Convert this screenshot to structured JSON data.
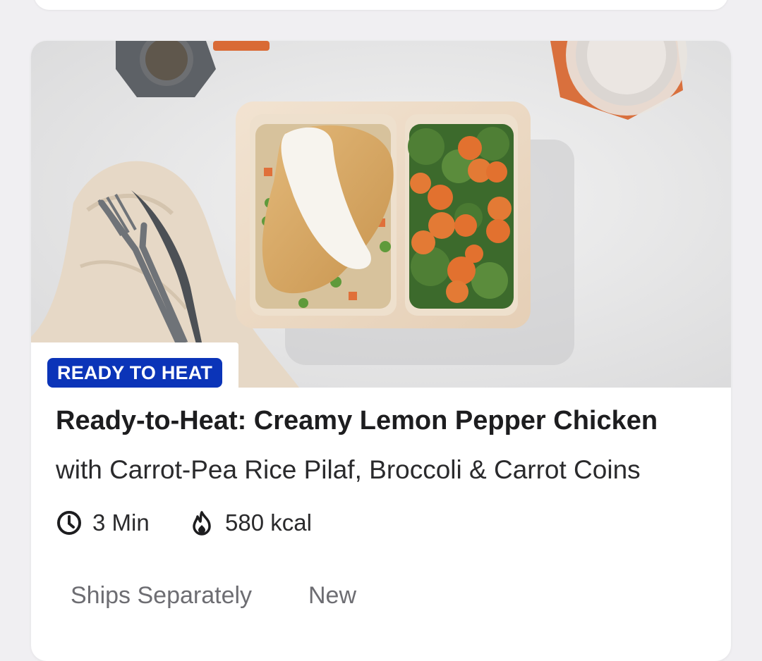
{
  "card": {
    "image_alt": "Ready-to-Heat Creamy Lemon Pepper Chicken meal in a two-compartment tray",
    "badge": "READY TO HEAT",
    "title": "Ready-to-Heat: Creamy Lemon Pepper Chicken",
    "subtitle": "with Carrot-Pea Rice Pilaf, Broccoli & Carrot Coins",
    "prep_time": "3 Min",
    "calories": "580 kcal",
    "tags": [
      "Ships Separately",
      "New"
    ]
  },
  "icons": {
    "time": "clock-icon",
    "calories": "flame-icon"
  },
  "colors": {
    "badge_bg": "#0b34b8",
    "badge_text": "#ffffff",
    "title_text": "#1d1d1f",
    "tag_text": "#6d6d72"
  }
}
